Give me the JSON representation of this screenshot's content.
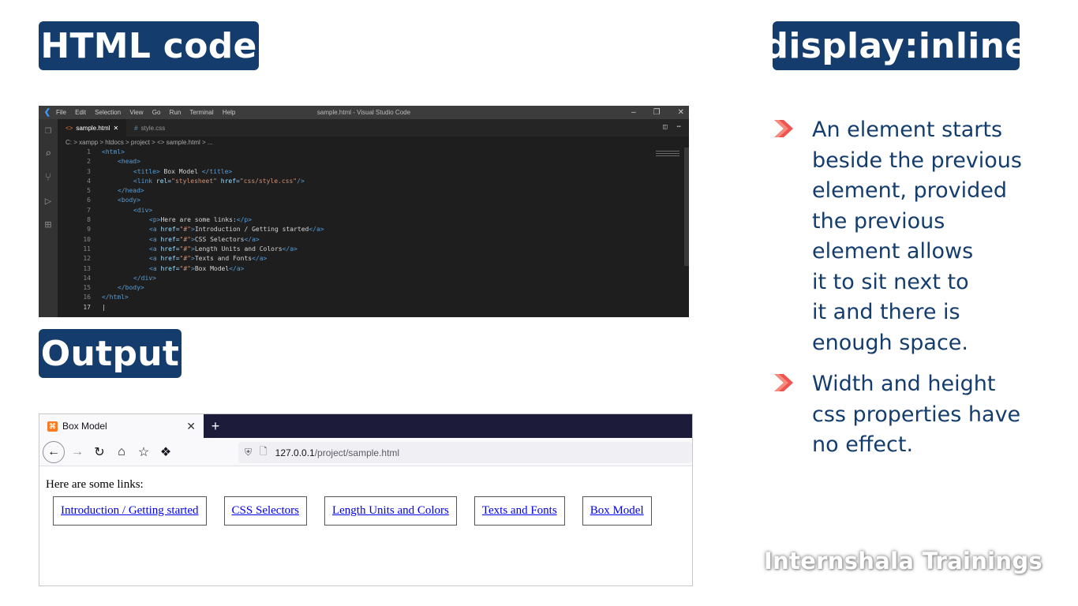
{
  "labels": {
    "html_code": "HTML code",
    "output": "Output",
    "display_inline": "display:inline"
  },
  "vscode": {
    "menu": [
      "File",
      "Edit",
      "Selection",
      "View",
      "Go",
      "Run",
      "Terminal",
      "Help"
    ],
    "window_title": "sample.html - Visual Studio Code",
    "tabs": [
      "sample.html",
      "style.css"
    ],
    "breadcrumb": "C: > xampp > htdocs > project > <> sample.html > ...",
    "line_numbers": [
      "1",
      "2",
      "3",
      "4",
      "5",
      "6",
      "7",
      "8",
      "9",
      "10",
      "11",
      "12",
      "13",
      "14",
      "15",
      "16",
      "17"
    ],
    "code": {
      "l1": "<html>",
      "l2": "<head>",
      "l3_tag_open": "<title>",
      "l3_text": " Box Model ",
      "l3_tag_close": "</title>",
      "l4_open": "<link ",
      "l4_attr1": "rel=",
      "l4_val1": "\"stylesheet\"",
      "l4_attr2": " href=",
      "l4_val2": "\"css/style.css\"",
      "l4_close": "/>",
      "l5": "</head>",
      "l6": "<body>",
      "l7": "<div>",
      "l8_open": "<p>",
      "l8_text": "Here are some links:",
      "l8_close": "</p>",
      "a_open": "<a ",
      "a_attr": "href=",
      "a_val": "\"#\"",
      "a_gt": ">",
      "a_close": "</a>",
      "l9_text": "Introduction / Getting started",
      "l10_text": "CSS Selectors",
      "l11_text": "Length Units and Colors",
      "l12_text": "Texts and Fonts",
      "l13_text": "Box Model",
      "l14": "</div>",
      "l15": "</body>",
      "l16": "</html>"
    }
  },
  "browser": {
    "tab_title": "Box Model",
    "url_host": "127.0.0.1",
    "url_path": "/project/sample.html",
    "paragraph": "Here are some links:",
    "links": [
      "Introduction / Getting started",
      "CSS Selectors",
      "Length Units and Colors",
      "Texts and Fonts",
      "Box Model"
    ]
  },
  "bullets": [
    "An element starts beside the previous element, provided the previous element allows it to sit next to it and there is enough space.",
    "Width and height css properties have no effect."
  ],
  "bullet_lines": [
    [
      "An element starts",
      "beside the previous",
      "element, provided",
      "the previous",
      "element allows",
      "it to sit next to",
      "it and there is",
      "enough space."
    ],
    [
      "Width and height",
      "css properties have",
      "no effect."
    ]
  ],
  "watermark": "Internshala Trainings",
  "colors": {
    "label_bg": "#143d6e",
    "bullet_text": "#143d6e",
    "chevron": "#f0524f"
  }
}
